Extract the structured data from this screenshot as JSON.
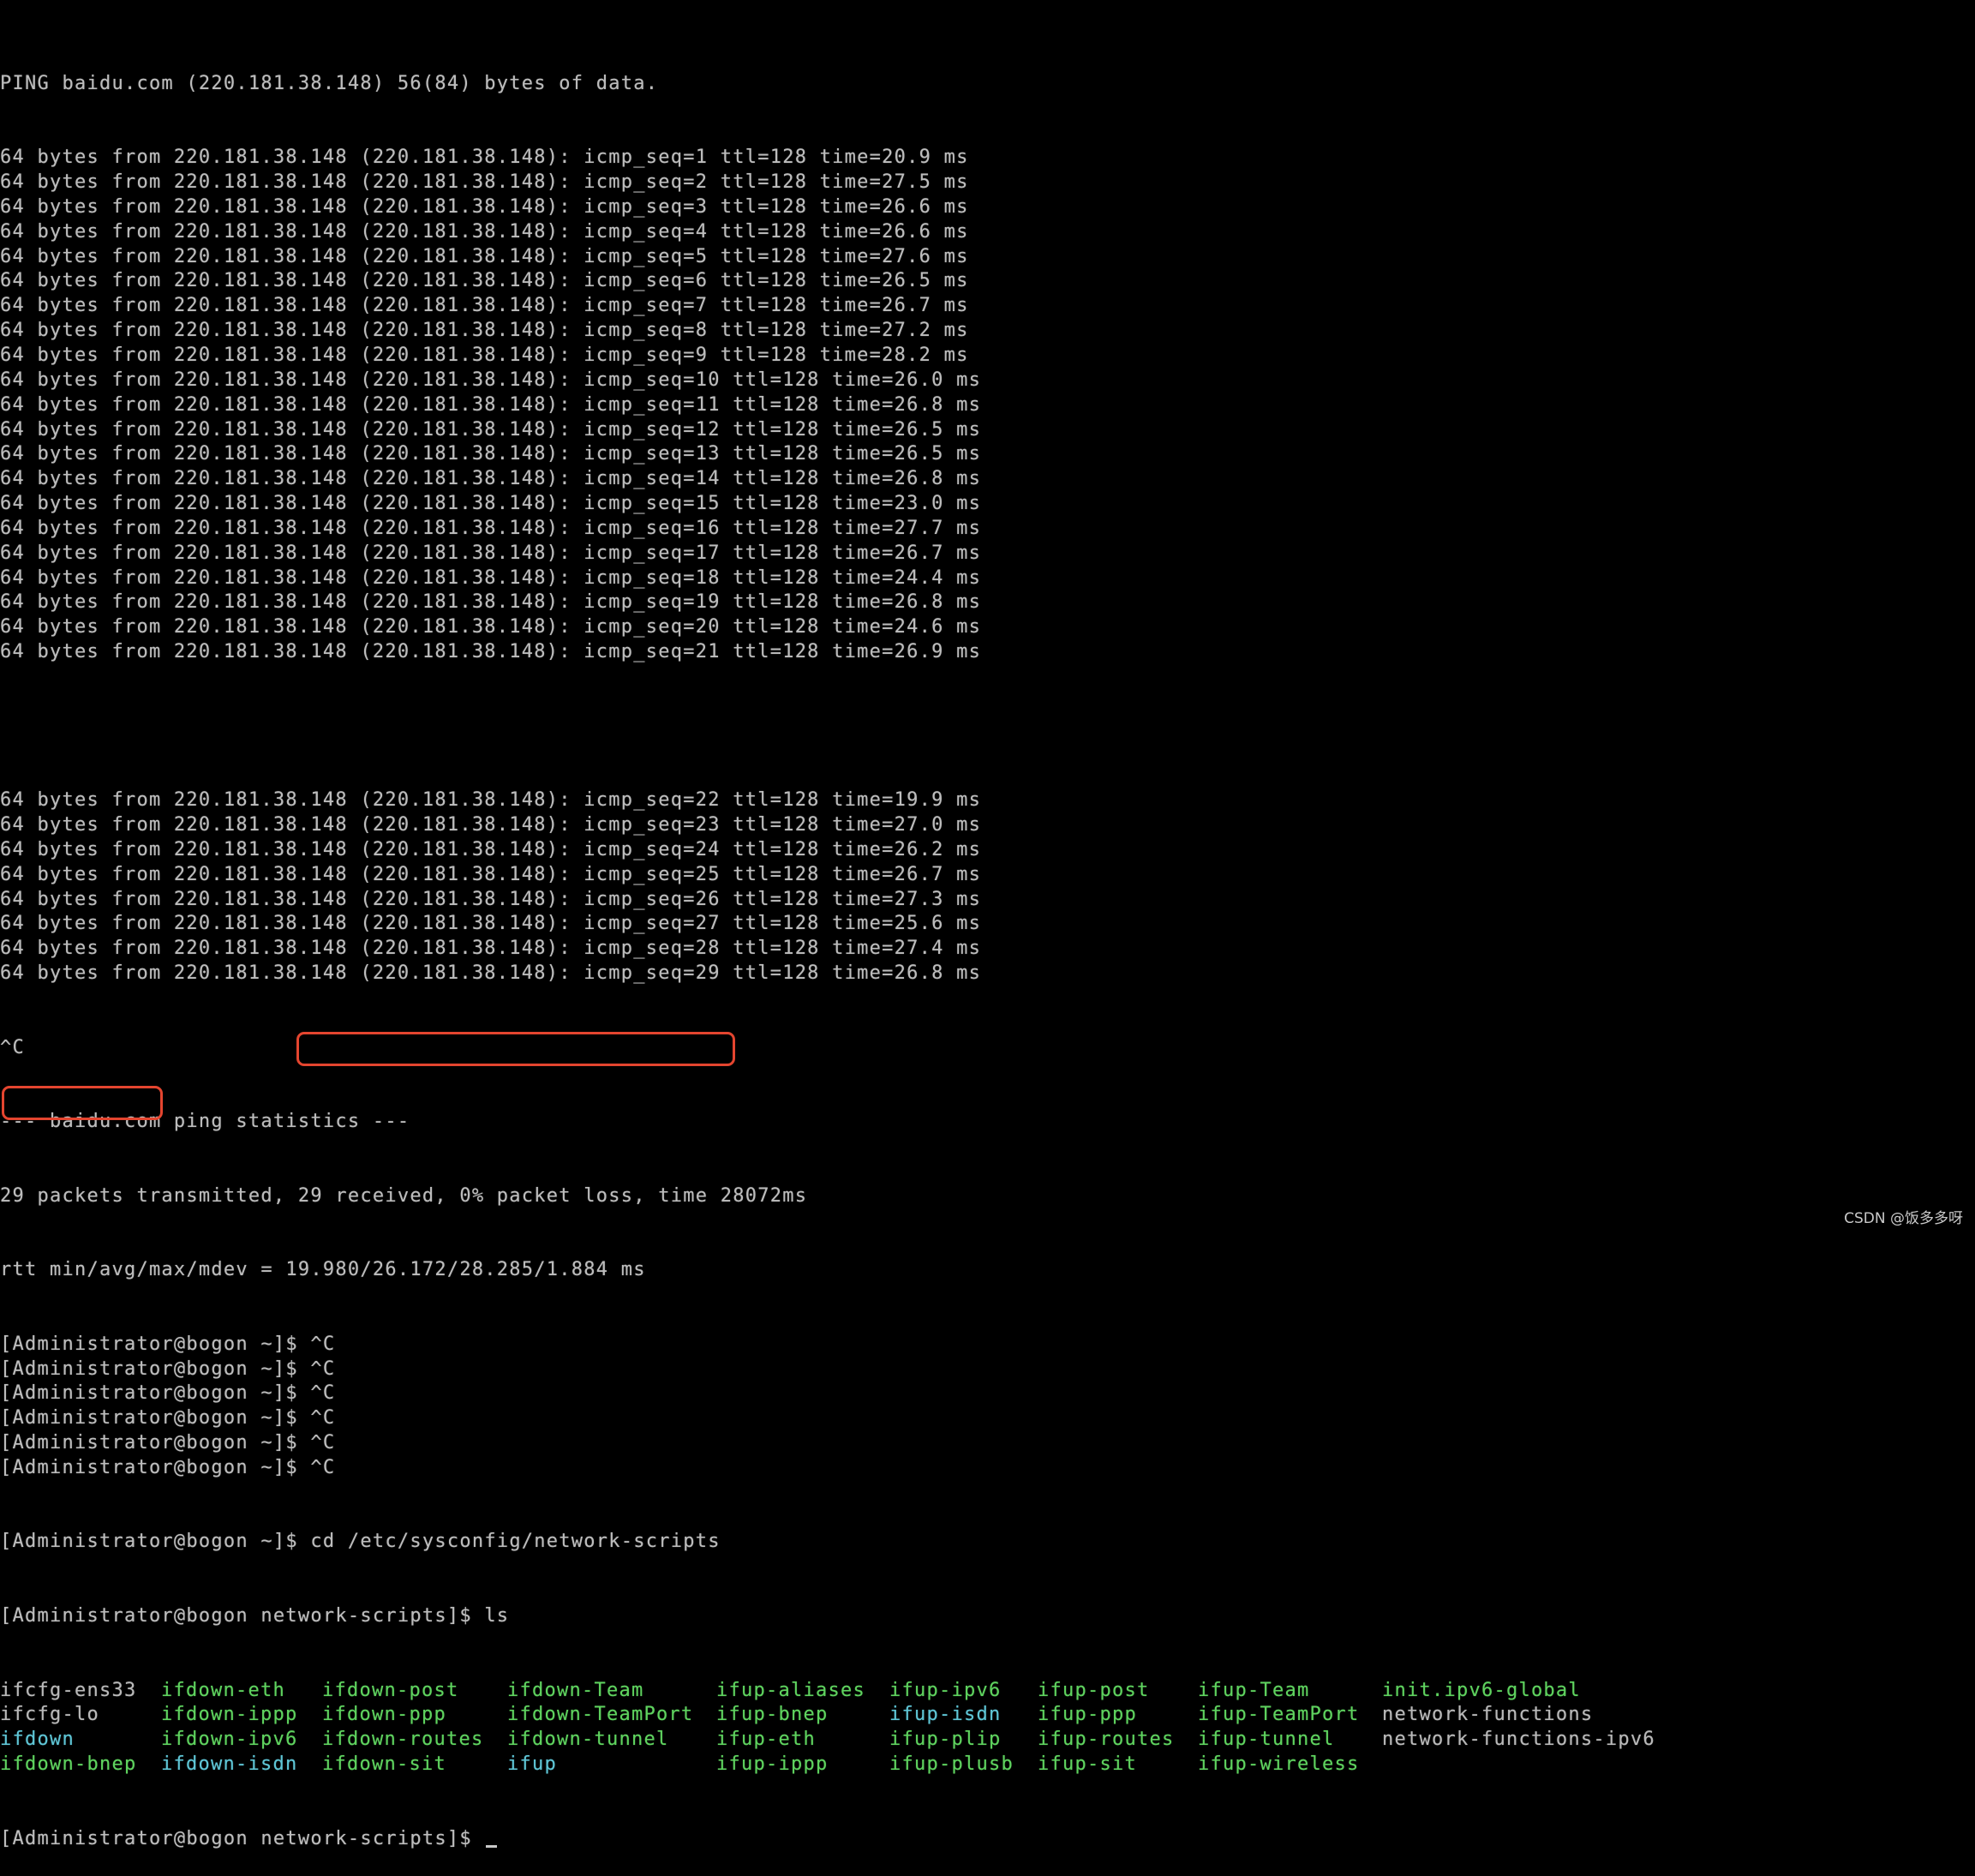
{
  "terminal": {
    "ping_header": "PING baidu.com (220.181.38.148) 56(84) bytes of data.",
    "ping_replies_1": [
      "64 bytes from 220.181.38.148 (220.181.38.148): icmp_seq=1 ttl=128 time=20.9 ms",
      "64 bytes from 220.181.38.148 (220.181.38.148): icmp_seq=2 ttl=128 time=27.5 ms",
      "64 bytes from 220.181.38.148 (220.181.38.148): icmp_seq=3 ttl=128 time=26.6 ms",
      "64 bytes from 220.181.38.148 (220.181.38.148): icmp_seq=4 ttl=128 time=26.6 ms",
      "64 bytes from 220.181.38.148 (220.181.38.148): icmp_seq=5 ttl=128 time=27.6 ms",
      "64 bytes from 220.181.38.148 (220.181.38.148): icmp_seq=6 ttl=128 time=26.5 ms",
      "64 bytes from 220.181.38.148 (220.181.38.148): icmp_seq=7 ttl=128 time=26.7 ms",
      "64 bytes from 220.181.38.148 (220.181.38.148): icmp_seq=8 ttl=128 time=27.2 ms",
      "64 bytes from 220.181.38.148 (220.181.38.148): icmp_seq=9 ttl=128 time=28.2 ms",
      "64 bytes from 220.181.38.148 (220.181.38.148): icmp_seq=10 ttl=128 time=26.0 ms",
      "64 bytes from 220.181.38.148 (220.181.38.148): icmp_seq=11 ttl=128 time=26.8 ms",
      "64 bytes from 220.181.38.148 (220.181.38.148): icmp_seq=12 ttl=128 time=26.5 ms",
      "64 bytes from 220.181.38.148 (220.181.38.148): icmp_seq=13 ttl=128 time=26.5 ms",
      "64 bytes from 220.181.38.148 (220.181.38.148): icmp_seq=14 ttl=128 time=26.8 ms",
      "64 bytes from 220.181.38.148 (220.181.38.148): icmp_seq=15 ttl=128 time=23.0 ms",
      "64 bytes from 220.181.38.148 (220.181.38.148): icmp_seq=16 ttl=128 time=27.7 ms",
      "64 bytes from 220.181.38.148 (220.181.38.148): icmp_seq=17 ttl=128 time=26.7 ms",
      "64 bytes from 220.181.38.148 (220.181.38.148): icmp_seq=18 ttl=128 time=24.4 ms",
      "64 bytes from 220.181.38.148 (220.181.38.148): icmp_seq=19 ttl=128 time=26.8 ms",
      "64 bytes from 220.181.38.148 (220.181.38.148): icmp_seq=20 ttl=128 time=24.6 ms",
      "64 bytes from 220.181.38.148 (220.181.38.148): icmp_seq=21 ttl=128 time=26.9 ms"
    ],
    "ping_replies_2": [
      "64 bytes from 220.181.38.148 (220.181.38.148): icmp_seq=22 ttl=128 time=19.9 ms",
      "64 bytes from 220.181.38.148 (220.181.38.148): icmp_seq=23 ttl=128 time=27.0 ms",
      "64 bytes from 220.181.38.148 (220.181.38.148): icmp_seq=24 ttl=128 time=26.2 ms",
      "64 bytes from 220.181.38.148 (220.181.38.148): icmp_seq=25 ttl=128 time=26.7 ms",
      "64 bytes from 220.181.38.148 (220.181.38.148): icmp_seq=26 ttl=128 time=27.3 ms",
      "64 bytes from 220.181.38.148 (220.181.38.148): icmp_seq=27 ttl=128 time=25.6 ms",
      "64 bytes from 220.181.38.148 (220.181.38.148): icmp_seq=28 ttl=128 time=27.4 ms",
      "64 bytes from 220.181.38.148 (220.181.38.148): icmp_seq=29 ttl=128 time=26.8 ms"
    ],
    "interrupt": "^C",
    "stats_header": "--- baidu.com ping statistics ---",
    "stats_packets": "29 packets transmitted, 29 received, 0% packet loss, time 28072ms",
    "stats_rtt": "rtt min/avg/max/mdev = 19.980/26.172/28.285/1.884 ms",
    "home_prompt": "[Administrator@bogon ~]$ ",
    "interrupt_prompts": [
      "^C",
      "^C",
      "^C",
      "^C",
      "^C",
      "^C"
    ],
    "cd_command": "cd /etc/sysconfig/network-scripts",
    "scripts_prompt": "[Administrator@bogon network-scripts]$ ",
    "ls_command": "ls",
    "ls_rows": [
      [
        {
          "name": "ifcfg-ens33",
          "type": "file"
        },
        {
          "name": "ifdown-eth",
          "type": "exec"
        },
        {
          "name": "ifdown-post",
          "type": "exec"
        },
        {
          "name": "ifdown-Team",
          "type": "exec"
        },
        {
          "name": "ifup-aliases",
          "type": "exec"
        },
        {
          "name": "ifup-ipv6",
          "type": "exec"
        },
        {
          "name": "ifup-post",
          "type": "exec"
        },
        {
          "name": "ifup-Team",
          "type": "exec"
        },
        {
          "name": "init.ipv6-global",
          "type": "exec"
        }
      ],
      [
        {
          "name": "ifcfg-lo",
          "type": "file"
        },
        {
          "name": "ifdown-ippp",
          "type": "exec"
        },
        {
          "name": "ifdown-ppp",
          "type": "exec"
        },
        {
          "name": "ifdown-TeamPort",
          "type": "exec"
        },
        {
          "name": "ifup-bnep",
          "type": "exec"
        },
        {
          "name": "ifup-isdn",
          "type": "link"
        },
        {
          "name": "ifup-ppp",
          "type": "exec"
        },
        {
          "name": "ifup-TeamPort",
          "type": "exec"
        },
        {
          "name": "network-functions",
          "type": "file"
        }
      ],
      [
        {
          "name": "ifdown",
          "type": "link"
        },
        {
          "name": "ifdown-ipv6",
          "type": "exec"
        },
        {
          "name": "ifdown-routes",
          "type": "exec"
        },
        {
          "name": "ifdown-tunnel",
          "type": "exec"
        },
        {
          "name": "ifup-eth",
          "type": "exec"
        },
        {
          "name": "ifup-plip",
          "type": "exec"
        },
        {
          "name": "ifup-routes",
          "type": "exec"
        },
        {
          "name": "ifup-tunnel",
          "type": "exec"
        },
        {
          "name": "network-functions-ipv6",
          "type": "file"
        }
      ],
      [
        {
          "name": "ifdown-bnep",
          "type": "exec"
        },
        {
          "name": "ifdown-isdn",
          "type": "link"
        },
        {
          "name": "ifdown-sit",
          "type": "exec"
        },
        {
          "name": "ifup",
          "type": "link"
        },
        {
          "name": "ifup-ippp",
          "type": "exec"
        },
        {
          "name": "ifup-plusb",
          "type": "exec"
        },
        {
          "name": "ifup-sit",
          "type": "exec"
        },
        {
          "name": "ifup-wireless",
          "type": "exec"
        }
      ]
    ],
    "final_prompt": "[Administrator@bogon network-scripts]$ "
  },
  "colors": {
    "background": "#000000",
    "text": "#bdbdbd",
    "exec_file": "#5fd35f",
    "symlink": "#5fc6d6",
    "highlight_box": "#e4452f"
  },
  "watermark": "CSDN @饭多多呀"
}
